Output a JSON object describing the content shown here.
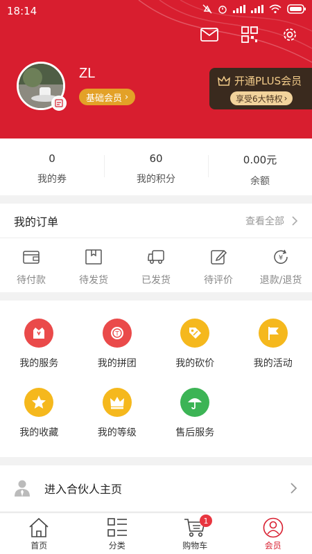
{
  "status_bar": {
    "time": "18:14"
  },
  "profile": {
    "username": "ZL",
    "member_level": "基础会员"
  },
  "plus": {
    "title": "开通PLUS会员",
    "subtitle": "享受6大特权"
  },
  "stats": [
    {
      "value": "0",
      "label": "我的券"
    },
    {
      "value": "60",
      "label": "我的积分"
    },
    {
      "value": "0.00元",
      "label": "余额"
    }
  ],
  "orders": {
    "title": "我的订单",
    "view_all": "查看全部",
    "items": [
      {
        "label": "待付款",
        "icon": "wallet-icon"
      },
      {
        "label": "待发货",
        "icon": "box-icon"
      },
      {
        "label": "已发货",
        "icon": "truck-icon"
      },
      {
        "label": "待评价",
        "icon": "edit-icon"
      },
      {
        "label": "退款/退货",
        "icon": "refund-icon"
      }
    ]
  },
  "services": [
    {
      "label": "我的服务",
      "icon": "service-icon",
      "color": "#ea4a4a"
    },
    {
      "label": "我的拼团",
      "icon": "group-buy-icon",
      "color": "#ea4a4a"
    },
    {
      "label": "我的砍价",
      "icon": "bargain-icon",
      "color": "#f5b81d"
    },
    {
      "label": "我的活动",
      "icon": "flag-icon",
      "color": "#f5b81d"
    },
    {
      "label": "我的收藏",
      "icon": "star-icon",
      "color": "#f5b81d"
    },
    {
      "label": "我的等级",
      "icon": "crown-icon",
      "color": "#f5b81d"
    },
    {
      "label": "售后服务",
      "icon": "umbrella-icon",
      "color": "#3cb455"
    }
  ],
  "partner": {
    "label": "进入合伙人主页"
  },
  "tabbar": {
    "items": [
      {
        "label": "首页"
      },
      {
        "label": "分类"
      },
      {
        "label": "购物车",
        "badge": "1"
      },
      {
        "label": "会员"
      }
    ]
  },
  "colors": {
    "brand": "#d81e2f",
    "gold": "#e3a127"
  }
}
